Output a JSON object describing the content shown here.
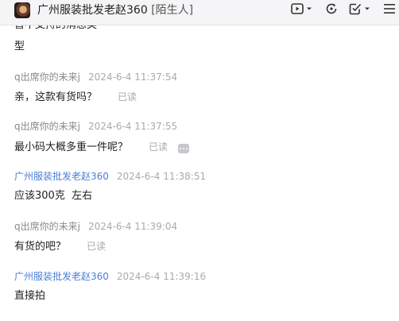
{
  "header": {
    "title": "广州服装批发老赵360",
    "stranger_tag": "[陌生人]"
  },
  "chat": {
    "fragment_line1": "暂不支持的消息类",
    "fragment_line2": "型",
    "messages": [
      {
        "sender": "q出席你的未来j",
        "time": "2024-6-4 11:37:54",
        "text": "亲，这款有货吗？",
        "status": "已读"
      },
      {
        "sender": "q出席你的未来j",
        "time": "2024-6-4 11:37:55",
        "text": "最小码大概多重一件呢？",
        "status": "已读"
      },
      {
        "sender": "广州服装批发老赵360",
        "time": "2024-6-4 11:38:51",
        "text": "应该300克  左右",
        "status": ""
      },
      {
        "sender": "q出席你的未来j",
        "time": "2024-6-4 11:39:04",
        "text": "有货的吧？",
        "status": "已读"
      },
      {
        "sender": "广州服装批发老赵360",
        "time": "2024-6-4 11:39:16",
        "text": "直接拍",
        "status": ""
      }
    ]
  },
  "icons": {
    "video": "video-call-icon",
    "refresh": "refresh-icon",
    "task": "task-check-icon",
    "menu": "menu-icon"
  }
}
